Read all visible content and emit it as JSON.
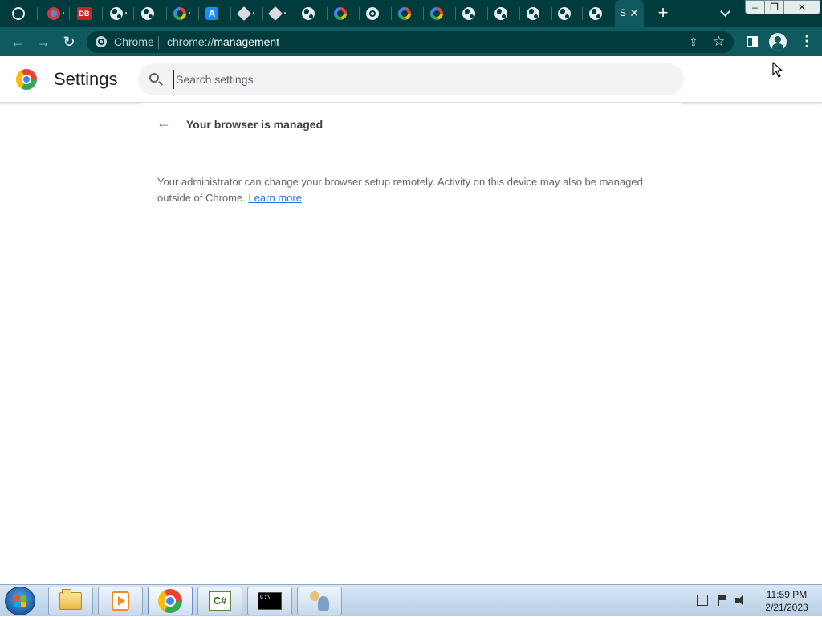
{
  "window": {
    "min_label": "–",
    "max_label": "❐",
    "close_label": "✕"
  },
  "tabs": [
    {
      "icon": "recent-history-icon"
    },
    {
      "icon": "red-circle-favicon-icon"
    },
    {
      "icon": "db-favicon-icon",
      "text": "DB"
    },
    {
      "icon": "globe-icon"
    },
    {
      "icon": "globe-icon"
    },
    {
      "icon": "google-g-icon"
    },
    {
      "icon": "app-store-icon",
      "text": "A"
    },
    {
      "icon": "dice-icon"
    },
    {
      "icon": "dice-icon"
    },
    {
      "icon": "globe-icon"
    },
    {
      "icon": "google-g-icon"
    },
    {
      "icon": "chrome-icon"
    },
    {
      "icon": "google-g-icon"
    },
    {
      "icon": "google-g-icon"
    },
    {
      "icon": "globe-icon"
    },
    {
      "icon": "globe-icon"
    },
    {
      "icon": "globe-icon"
    },
    {
      "icon": "globe-icon"
    },
    {
      "icon": "globe-icon"
    }
  ],
  "active_tab": {
    "title": "S",
    "close": "✕"
  },
  "new_tab_label": "+",
  "toolbar": {
    "back": "←",
    "forward": "→",
    "reload": "↻",
    "chip": "Chrome",
    "url_scheme": "chrome://",
    "url_host": "management",
    "share": "⇪",
    "star": "☆",
    "menu": "⋮"
  },
  "settings": {
    "title": "Settings",
    "search_placeholder": "Search settings"
  },
  "page": {
    "back_arrow": "←",
    "heading": "Your browser is managed",
    "description": "Your administrator can change your browser setup remotely. Activity on this device may also be managed outside of Chrome.",
    "learn_more": "Learn more"
  },
  "taskbar": {
    "apps": [
      {
        "name": "Windows Explorer",
        "icon": "folder-icon"
      },
      {
        "name": "Media Player",
        "icon": "media-player-icon"
      },
      {
        "name": "Google Chrome",
        "icon": "chrome-icon",
        "active": true
      },
      {
        "name": "C# Editor",
        "icon": "csharp-icon",
        "text": "C#"
      },
      {
        "name": "Command Prompt",
        "icon": "cmd-icon",
        "text": "C:\\_"
      },
      {
        "name": "Users",
        "icon": "users-icon"
      }
    ],
    "clock_time": "11:59 PM",
    "clock_date": "2/21/2023"
  },
  "colors": {
    "tab_strip": "#003b3e",
    "toolbar": "#0e5a5f",
    "link": "#1a73e8",
    "taskbar": "#b8cfe6"
  }
}
